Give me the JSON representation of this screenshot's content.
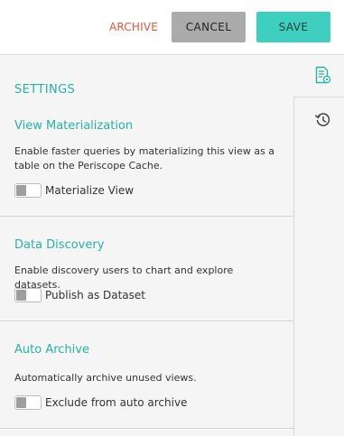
{
  "toolbar": {
    "archive_label": "ARCHIVE",
    "cancel_label": "CANCEL",
    "save_label": "SAVE"
  },
  "settings": {
    "title": "SETTINGS",
    "sections": [
      {
        "heading": "View Materialization",
        "description": "Enable faster queries by materializing this view as a table on the Periscope Cache.",
        "toggle_label": "Materialize View",
        "toggle_on": false
      },
      {
        "heading": "Data Discovery",
        "description": "Enable discovery users to chart and explore datasets.",
        "toggle_label": "Publish as Dataset",
        "toggle_on": false
      },
      {
        "heading": "Auto Archive",
        "description": "Automatically archive unused views.",
        "toggle_label": "Exclude from auto archive",
        "toggle_on": false
      }
    ]
  },
  "rail": {
    "icons": [
      "settings-document-icon",
      "history-icon"
    ]
  },
  "colors": {
    "accent": "#27b3a3",
    "save": "#3fcfbf",
    "archive": "#e0563d",
    "cancel": "#ababab"
  }
}
